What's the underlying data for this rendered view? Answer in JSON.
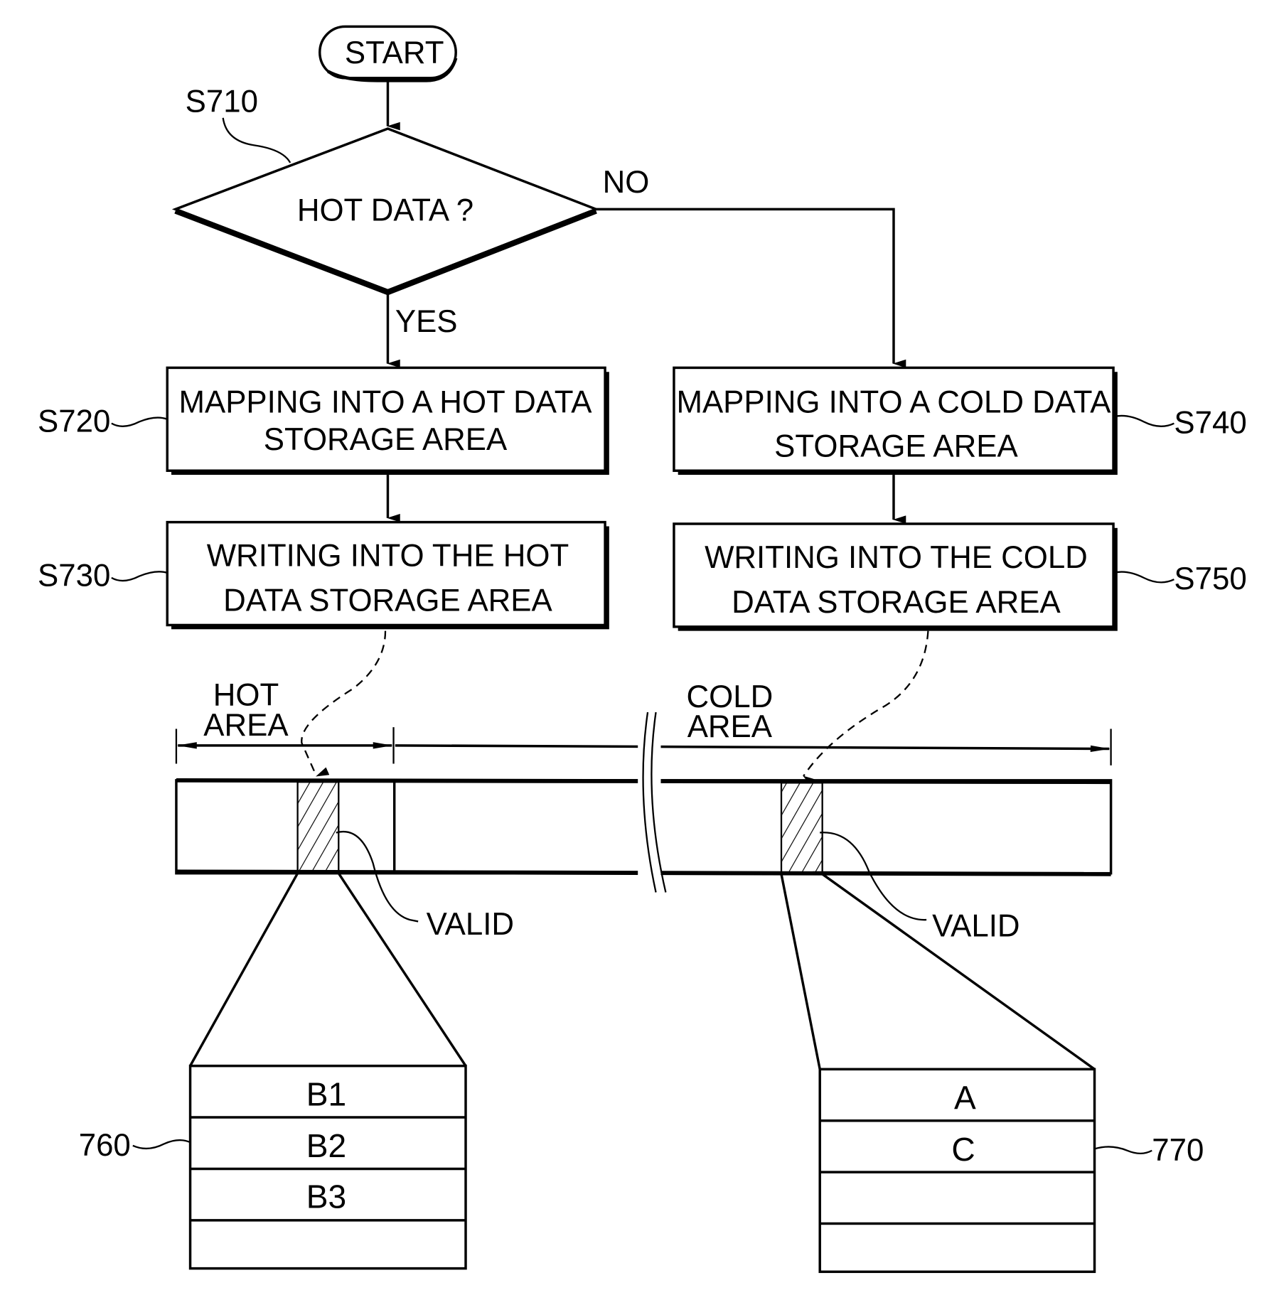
{
  "flowchart": {
    "start": "START",
    "decision": {
      "ref": "S710",
      "text": "HOT DATA ?",
      "yes": "YES",
      "no": "NO"
    },
    "steps": [
      {
        "ref": "S720",
        "lines": [
          "MAPPING INTO A HOT DATA",
          "STORAGE AREA"
        ]
      },
      {
        "ref": "S730",
        "lines": [
          "WRITING INTO THE HOT",
          "DATA STORAGE AREA"
        ]
      },
      {
        "ref": "S740",
        "lines": [
          "MAPPING INTO A COLD DATA",
          "STORAGE AREA"
        ]
      },
      {
        "ref": "S750",
        "lines": [
          "WRITING INTO THE COLD",
          "DATA STORAGE AREA"
        ]
      }
    ]
  },
  "memory": {
    "hot_area": [
      "HOT",
      "AREA"
    ],
    "cold_area": [
      "COLD",
      "AREA"
    ],
    "valid_hot": "VALID",
    "valid_cold": "VALID"
  },
  "blocks": {
    "hot": {
      "ref": "760",
      "rows": [
        "B1",
        "B2",
        "B3",
        ""
      ]
    },
    "cold": {
      "ref": "770",
      "rows": [
        "A",
        "C",
        "",
        ""
      ]
    }
  }
}
